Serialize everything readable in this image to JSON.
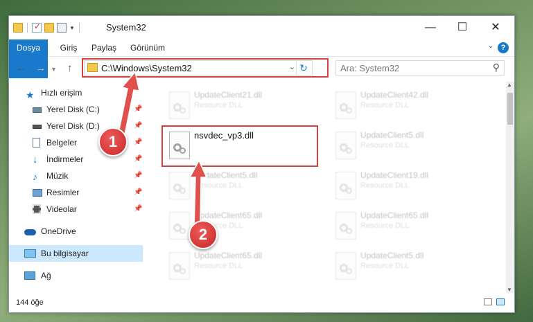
{
  "window": {
    "title": "System32",
    "controls": {
      "minimize": "—",
      "maximize": "☐",
      "close": "✕"
    }
  },
  "ribbon": {
    "tabs": [
      {
        "label": "Dosya"
      },
      {
        "label": "Giriş"
      },
      {
        "label": "Paylaş"
      },
      {
        "label": "Görünüm"
      }
    ],
    "help": "?"
  },
  "nav": {
    "back": "←",
    "forward": "→",
    "up": "↑",
    "address": "C:\\Windows\\System32",
    "search_placeholder": "Ara: System32"
  },
  "sidebar": {
    "items": [
      {
        "label": "Hızlı erişim",
        "icon": "star-icon",
        "pinned": false
      },
      {
        "label": "Yerel Disk (C:)",
        "icon": "drive-icon",
        "pinned": true
      },
      {
        "label": "Yerel Disk (D:)",
        "icon": "drive-icon",
        "pinned": true
      },
      {
        "label": "Belgeler",
        "icon": "documents-icon",
        "pinned": true
      },
      {
        "label": "İndirmeler",
        "icon": "download-icon",
        "pinned": true
      },
      {
        "label": "Müzik",
        "icon": "music-icon",
        "pinned": true
      },
      {
        "label": "Resimler",
        "icon": "pictures-icon",
        "pinned": true
      },
      {
        "label": "Videolar",
        "icon": "videos-icon",
        "pinned": true
      },
      {
        "label": "OneDrive",
        "icon": "cloud-icon",
        "pinned": false
      },
      {
        "label": "Bu bilgisayar",
        "icon": "computer-icon",
        "pinned": false
      },
      {
        "label": "Ağ",
        "icon": "network-icon",
        "pinned": false
      }
    ],
    "pin_glyph": "📌"
  },
  "files": [
    {
      "name": "UpdateClient21.dll",
      "type": "Resource DLL"
    },
    {
      "name": "UpdateClient42.dll",
      "type": "Resource DLL"
    },
    {
      "name": "nsvdec_vp3.dll",
      "type": ""
    },
    {
      "name": "UpdateClient5.dll",
      "type": "Resource DLL"
    },
    {
      "name": "UpdateClient5.dll",
      "type": "Resource DLL"
    },
    {
      "name": "UpdateClient19.dll",
      "type": "Resource DLL"
    },
    {
      "name": "UpdateClient65.dll",
      "type": "Resource DLL"
    },
    {
      "name": "UpdateClient65.dll",
      "type": "Resource DLL"
    },
    {
      "name": "UpdateClient65.dll",
      "type": "Resource DLL"
    },
    {
      "name": "UpdateClient5.dll",
      "type": "Resource DLL"
    }
  ],
  "status": {
    "item_count": "144 öğe"
  },
  "annotations": {
    "step1": "1",
    "step2": "2",
    "color": "#d7403f"
  }
}
